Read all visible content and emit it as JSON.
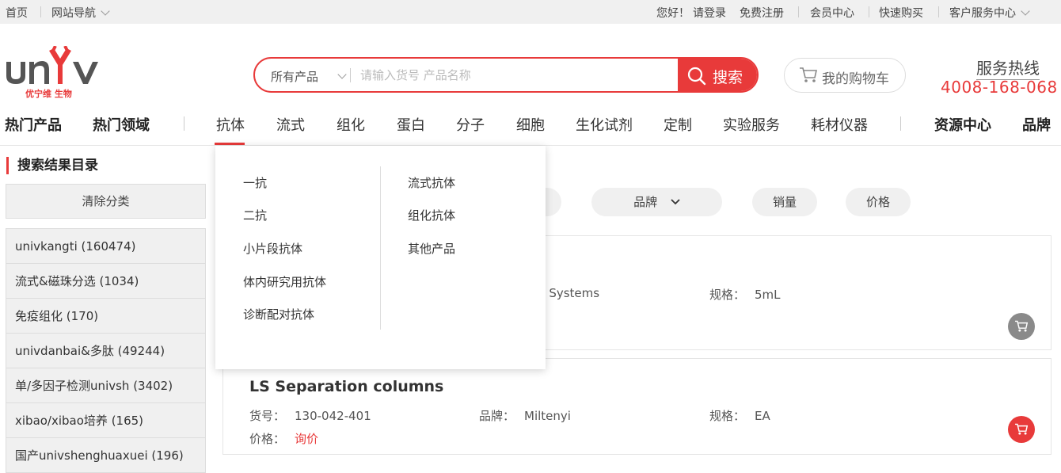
{
  "topbar": {
    "home": "首页",
    "site_nav": "网站导航",
    "greeting": "您好！",
    "login": "请登录",
    "register": "免费注册",
    "member_center": "会员中心",
    "quick_buy": "快速购买",
    "customer_service": "客户服务中心"
  },
  "logo": {
    "text": "univ",
    "subtitle": "优宁维 生物"
  },
  "search": {
    "category": "所有产品",
    "placeholder": "请输入货号 产品名称",
    "button": "搜索"
  },
  "cart": {
    "label": "我的购物车"
  },
  "hotline": {
    "title": "服务热线",
    "number": "4008-168-068"
  },
  "nav": {
    "hot_products": "热门产品",
    "hot_fields": "热门领域",
    "items": [
      "抗体",
      "流式",
      "组化",
      "蛋白",
      "分子",
      "细胞",
      "生化试剂",
      "定制",
      "实验服务",
      "耗材仪器"
    ],
    "resource_center": "资源中心",
    "brand": "品牌"
  },
  "sidebar": {
    "title": "搜索结果目录",
    "clear": "清除分类",
    "items": [
      "univkangti (160474)",
      "流式&磁珠分选 (1034)",
      "免疫组化 (170)",
      "univdanbai&多肽 (49244)",
      "单/多因子检测univsh (3402)",
      "xibao/xibao培养 (165)",
      "国产univshenghuaxuei (196)"
    ]
  },
  "sort": {
    "brand": "品牌",
    "sales": "销量",
    "price": "价格"
  },
  "products": [
    {
      "name": "",
      "brand_partial": "D Systems",
      "spec_label": "规格：",
      "spec": "5mL"
    },
    {
      "name": "LS Separation columns",
      "sku_label": "货号：",
      "sku": "130-042-401",
      "brand_label": "品牌：",
      "brand": "Miltenyi",
      "spec_label": "规格：",
      "spec": "EA",
      "price_label": "价格：",
      "price": "询价"
    }
  ],
  "dropdown": {
    "left": [
      "一抗",
      "二抗",
      "小片段抗体",
      "体内研究用抗体",
      "诊断配对抗体"
    ],
    "right": [
      "流式抗体",
      "组化抗体",
      "其他产品"
    ]
  },
  "colors": {
    "accent": "#e83a3a",
    "cart_grey": "#8a8a8a"
  }
}
